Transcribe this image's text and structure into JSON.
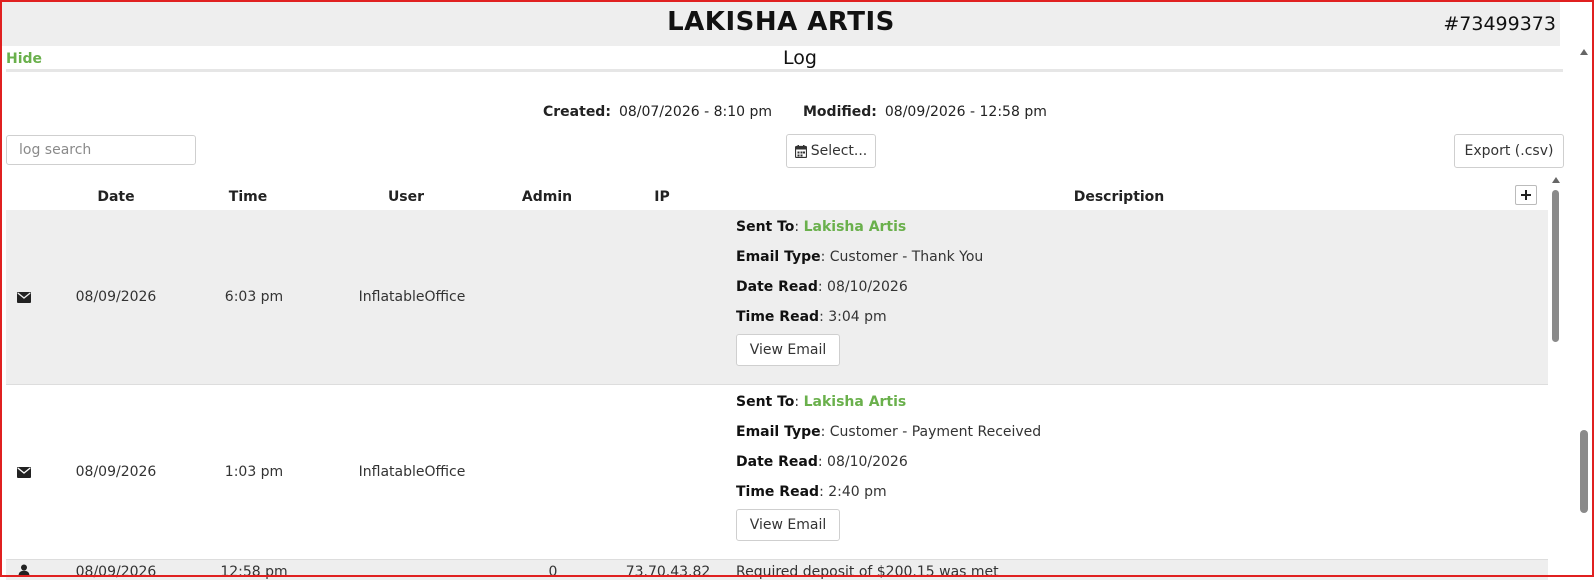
{
  "header": {
    "customer_name": "LAKISHA ARTIS",
    "order_number": "#73499373"
  },
  "log": {
    "hide_label": "Hide",
    "title": "Log",
    "created_label": "Created:",
    "created_value": "08/07/2026 - 8:10 pm",
    "modified_label": "Modified:",
    "modified_value": "08/09/2026 - 12:58 pm",
    "search_placeholder": "log search",
    "select_label": "Select...",
    "export_label": "Export (.csv)",
    "columns": [
      "Date",
      "Time",
      "User",
      "Admin",
      "IP",
      "Description"
    ],
    "rows": [
      {
        "icon": "envelope-icon",
        "date": "08/09/2026",
        "time": "6:03 pm",
        "user": "InflatableOffice",
        "admin": "",
        "ip": "",
        "sent_to_label": "Sent To",
        "sent_to": "Lakisha Artis",
        "email_type_label": "Email Type",
        "email_type": "Customer - Thank You",
        "date_read_label": "Date Read",
        "date_read": "08/10/2026",
        "time_read_label": "Time Read",
        "time_read": "3:04 pm",
        "button_label": "View Email"
      },
      {
        "icon": "envelope-icon",
        "date": "08/09/2026",
        "time": "1:03 pm",
        "user": "InflatableOffice",
        "admin": "",
        "ip": "",
        "sent_to_label": "Sent To",
        "sent_to": "Lakisha Artis",
        "email_type_label": "Email Type",
        "email_type": "Customer - Payment Received",
        "date_read_label": "Date Read",
        "date_read": "08/10/2026",
        "time_read_label": "Time Read",
        "time_read": "2:40 pm",
        "button_label": "View Email"
      },
      {
        "icon": "user-icon",
        "date": "08/09/2026",
        "time": "12:58 pm",
        "user": "",
        "admin": "0",
        "ip": "73.70.43.82",
        "description": "Required deposit of $200.15 was met"
      }
    ]
  },
  "colors": {
    "accent_green": "#6ab04c",
    "frame_red": "#e02020",
    "row_shade": "#eeeeee"
  }
}
